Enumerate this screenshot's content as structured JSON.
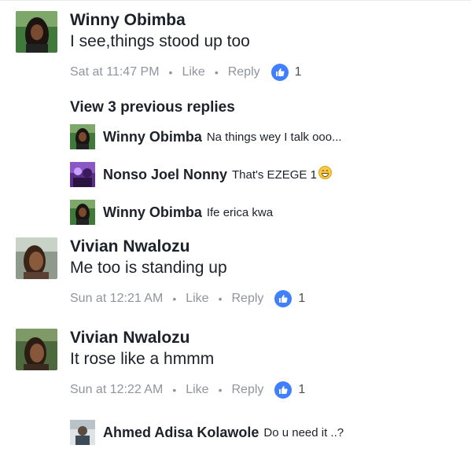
{
  "comments": [
    {
      "name": "Winny Obimba",
      "text": "I see,things stood up too",
      "time": "Sat at 11:47 PM",
      "like_label": "Like",
      "reply_label": "Reply",
      "like_count": "1"
    },
    {
      "name": "Vivian Nwalozu",
      "text": "Me too is standing up",
      "time": "Sun at 12:21 AM",
      "like_label": "Like",
      "reply_label": "Reply",
      "like_count": "1"
    },
    {
      "name": "Vivian Nwalozu",
      "text": "It rose like a hmmm",
      "time": "Sun at 12:22 AM",
      "like_label": "Like",
      "reply_label": "Reply",
      "like_count": "1"
    }
  ],
  "thread": {
    "view_previous": "View 3 previous replies",
    "replies": [
      {
        "name": "Winny Obimba",
        "text": "Na things wey I talk ooo..."
      },
      {
        "name": "Nonso Joel Nonny",
        "text": "That's EZEGE 1",
        "emoji": "grinning-face-icon"
      },
      {
        "name": "Winny Obimba",
        "text": "Ife erica kwa"
      }
    ]
  },
  "last_reply": {
    "name": "Ahmed Adisa Kolawole",
    "text": "Do u need it ..?"
  },
  "colors": {
    "like_blue": "#4080ff",
    "meta_gray": "#90949c",
    "name_dark": "#1d2129"
  }
}
